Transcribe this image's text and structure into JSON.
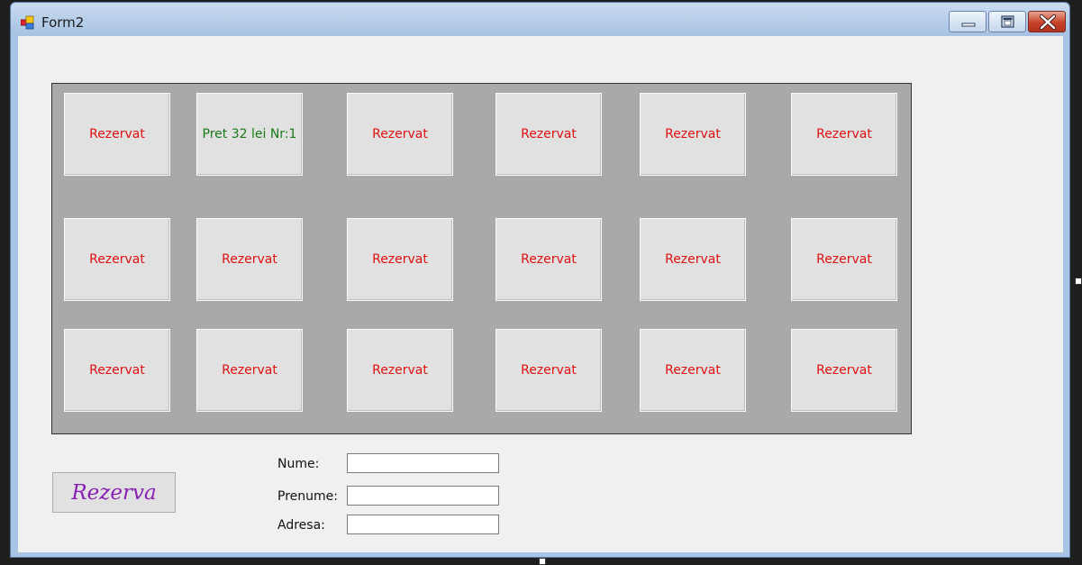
{
  "window": {
    "title": "Form2"
  },
  "seats": [
    {
      "label": "Rezervat",
      "status": "reserved"
    },
    {
      "label": "Pret 32 lei Nr:1",
      "status": "free"
    },
    {
      "label": "Rezervat",
      "status": "reserved"
    },
    {
      "label": "Rezervat",
      "status": "reserved"
    },
    {
      "label": "Rezervat",
      "status": "reserved"
    },
    {
      "label": "Rezervat",
      "status": "reserved"
    },
    {
      "label": "Rezervat",
      "status": "reserved"
    },
    {
      "label": "Rezervat",
      "status": "reserved"
    },
    {
      "label": "Rezervat",
      "status": "reserved"
    },
    {
      "label": "Rezervat",
      "status": "reserved"
    },
    {
      "label": "Rezervat",
      "status": "reserved"
    },
    {
      "label": "Rezervat",
      "status": "reserved"
    },
    {
      "label": "Rezervat",
      "status": "reserved"
    },
    {
      "label": "Rezervat",
      "status": "reserved"
    },
    {
      "label": "Rezervat",
      "status": "reserved"
    },
    {
      "label": "Rezervat",
      "status": "reserved"
    },
    {
      "label": "Rezervat",
      "status": "reserved"
    },
    {
      "label": "Rezervat",
      "status": "reserved"
    }
  ],
  "reserve_button": {
    "label": "Rezerva"
  },
  "form": {
    "nume": {
      "label": "Nume:",
      "value": ""
    },
    "prenume": {
      "label": "Prenume:",
      "value": ""
    },
    "adresa": {
      "label": "Adresa:",
      "value": ""
    }
  },
  "colors": {
    "reserved": "#e01010",
    "free": "#1a7a1a",
    "reserve_button_text": "#8a1fb5"
  }
}
